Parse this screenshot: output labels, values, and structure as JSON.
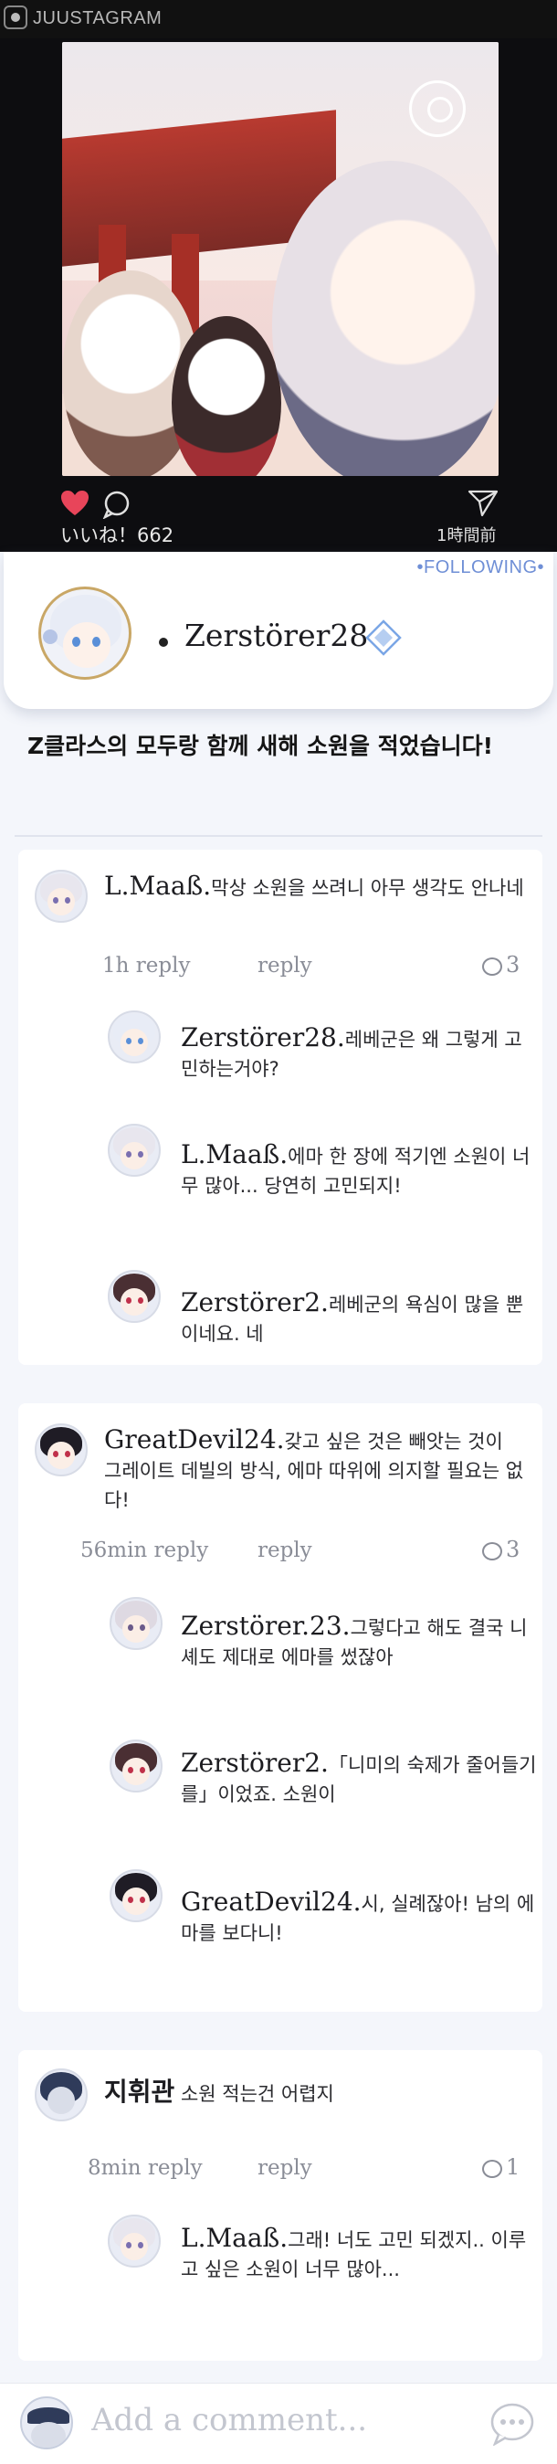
{
  "app": {
    "name": "JUUSTAGRAM"
  },
  "post": {
    "likes": "いいね！662",
    "time_ago": "1時間前"
  },
  "profile": {
    "following": "•FOLLOWING•",
    "bullet": "•",
    "username": "Zerstörer28"
  },
  "post_text": "Z클라스의 모두랑 함께 새해 소원을 적었습니다!",
  "threads": [
    {
      "user": "L.Maaß.",
      "text": "막상 소원을 쓰려니 아무 생각도 안나네",
      "time": "1h reply",
      "reply": "reply",
      "count": "3",
      "replies": [
        {
          "user": "Zerstörer28.",
          "text": "레베군은 왜 그렇게 고민하는거야?"
        },
        {
          "user": "L.Maaß.",
          "text": "에마 한 장에 적기엔 소원이 너무 많아... 당연히 고민되지!"
        },
        {
          "user": "Zerstörer2.",
          "text": "레베군의 욕심이 많을 뿐이네요. 네"
        }
      ]
    },
    {
      "user": "GreatDevil24.",
      "text": "갖고 싶은 것은 빼앗는 것이 그레이트 데빌의 방식, 에마 따위에 의지할 필요는 없다!",
      "time": "56min reply",
      "reply": "reply",
      "count": "3",
      "replies": [
        {
          "user": "Zerstörer.23.",
          "text": "그렇다고 해도 결국 니셰도 제대로 에마를 썼잖아"
        },
        {
          "user": "Zerstörer2.",
          "text": "「니미의 숙제가 줄어들기를」이었죠. 소원이"
        },
        {
          "user": "GreatDevil24.",
          "text": "시, 실례잖아! 남의 에마를 보다니!"
        }
      ]
    },
    {
      "user": "지휘관",
      "text": "소원 적는건 어렵지",
      "time": "8min reply",
      "reply": "reply",
      "count": "1",
      "replies": [
        {
          "user": "L.Maaß.",
          "text": "그래! 너도 고민 되겠지.. 이루고 싶은 소원이 너무 많아..."
        }
      ]
    }
  ],
  "composer": {
    "placeholder": "Add a comment..."
  },
  "colors": {
    "accent": "#6f8fd6",
    "heart": "#e8455a",
    "panel": "#f4f6fb"
  },
  "icons": [
    "app-logo-icon",
    "heart-icon",
    "comment-icon",
    "share-icon",
    "verified-icon",
    "reply-count-icon",
    "chat-icon"
  ]
}
